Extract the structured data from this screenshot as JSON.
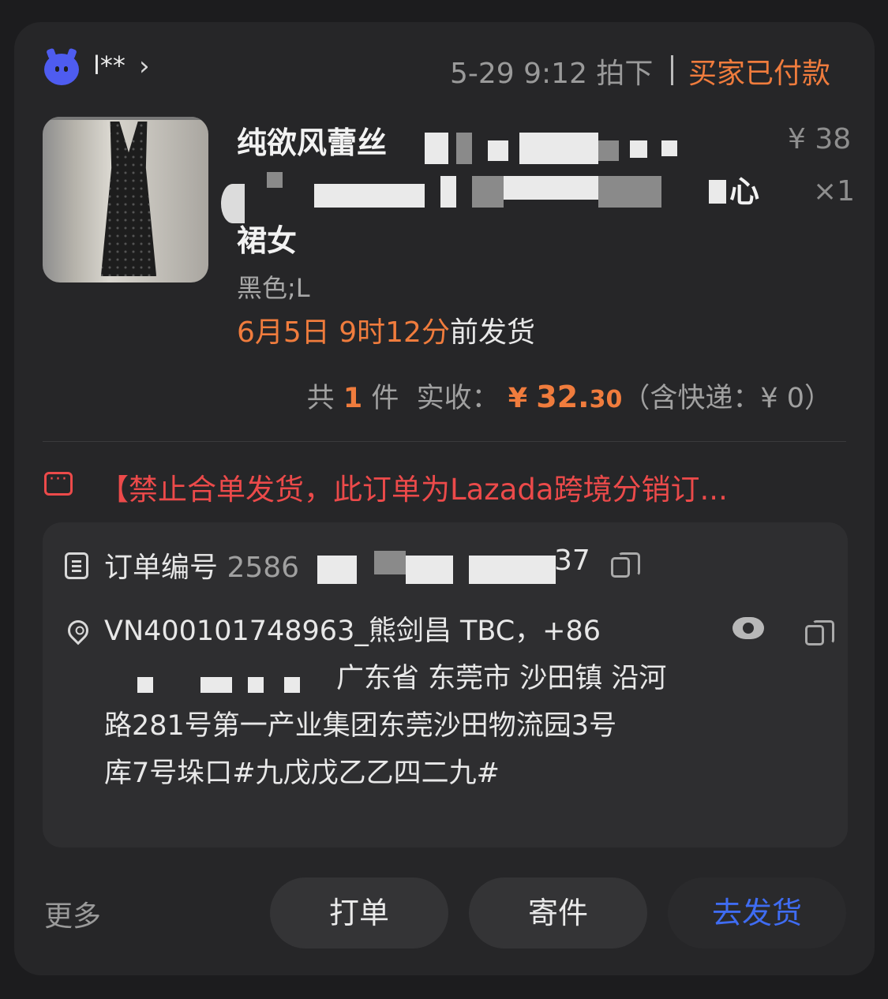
{
  "header": {
    "buyer_name": "l**",
    "order_time": "5-29 9:12 拍下",
    "status": "买家已付款"
  },
  "product": {
    "name_line1": "纯欲风蕾丝",
    "name_line2_end": "心",
    "name_line3": "裙女",
    "price": "¥ 38",
    "quantity": "×1",
    "spec": "黑色;L",
    "deadline_date": "6月5日 9时12分",
    "deadline_suffix": "前发货"
  },
  "summary": {
    "prefix": "共",
    "count": "1",
    "count_unit": "件",
    "received_label": "实收：",
    "currency": "¥",
    "amount_int": "32.",
    "amount_dec": "30",
    "shipping": "（含快递：¥ 0）"
  },
  "notice": {
    "text": "【禁止合单发货，此订单为Lazada跨境分销订..."
  },
  "order": {
    "label": "订单编号",
    "number_start": "2586",
    "number_end": "37"
  },
  "address": {
    "line1": "VN400101748963_熊剑昌 TBC，+86",
    "line2": "广东省 东莞市 沙田镇 沿河",
    "line3": "路281号第一产业集团东莞沙田物流园3号",
    "line4": "库7号垛口#九戊戊乙乙四二九#"
  },
  "footer": {
    "more": "更多",
    "print_button": "打单",
    "send_button": "寄件",
    "ship_button": "去发货"
  },
  "colors": {
    "accent_orange": "#f07c3d",
    "warning_red": "#ec4a4a",
    "primary_blue": "#3f6cf2",
    "background": "#262628"
  }
}
